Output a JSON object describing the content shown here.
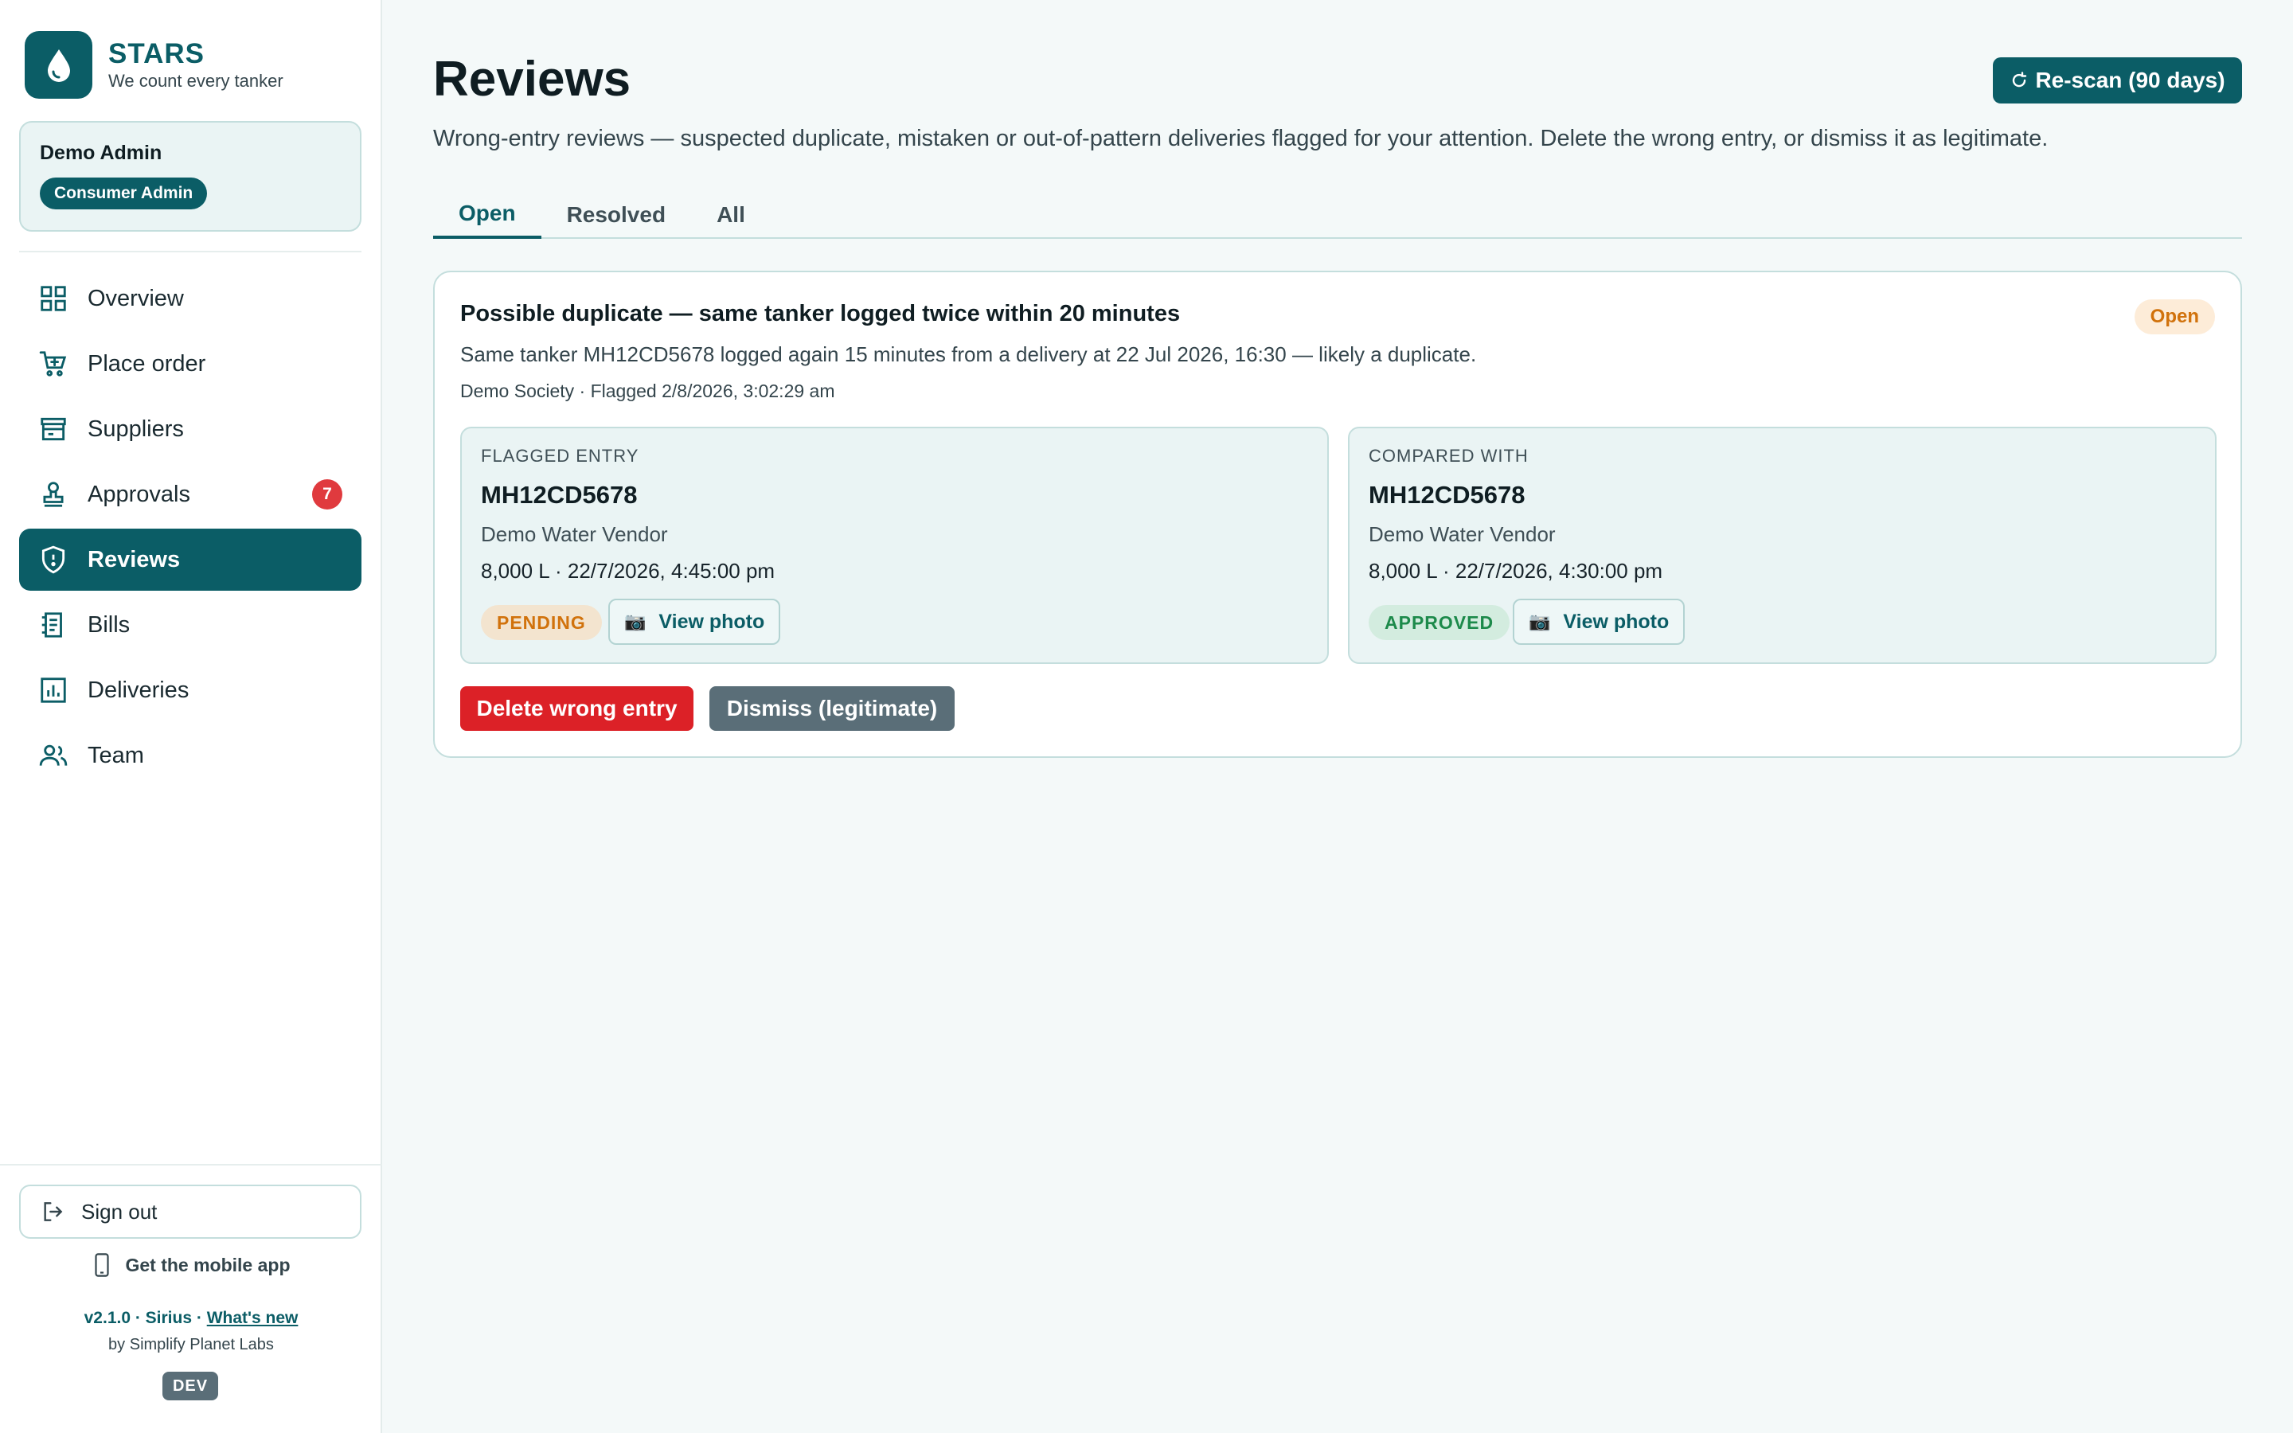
{
  "brand": {
    "name": "STARS",
    "tagline": "We count every tanker",
    "logo_icon": "water-drop-icon"
  },
  "user": {
    "name": "Demo Admin",
    "role": "Consumer Admin"
  },
  "nav": [
    {
      "label": "Overview",
      "icon": "grid-icon"
    },
    {
      "label": "Place order",
      "icon": "cart-icon"
    },
    {
      "label": "Suppliers",
      "icon": "store-icon"
    },
    {
      "label": "Approvals",
      "icon": "stamp-icon",
      "badge": "7"
    },
    {
      "label": "Reviews",
      "icon": "shield-icon",
      "active": true
    },
    {
      "label": "Bills",
      "icon": "receipt-icon"
    },
    {
      "label": "Deliveries",
      "icon": "bar-chart-icon"
    },
    {
      "label": "Team",
      "icon": "people-icon"
    }
  ],
  "footer": {
    "sign_out": "Sign out",
    "mobile_app": "Get the mobile app",
    "version": "v2.1.0 · Sirius · ",
    "whats_new": "What's new",
    "byline": "by Simplify Planet Labs",
    "env_badge": "DEV"
  },
  "page": {
    "title": "Reviews",
    "rescan_label": "Re-scan (90 days)",
    "subtitle": "Wrong-entry reviews — suspected duplicate, mistaken or out-of-pattern deliveries flagged for your attention. Delete the wrong entry, or dismiss it as legitimate."
  },
  "tabs": [
    {
      "label": "Open",
      "active": true
    },
    {
      "label": "Resolved"
    },
    {
      "label": "All"
    }
  ],
  "review": {
    "title": "Possible duplicate — same tanker logged twice within 20 minutes",
    "status": "Open",
    "description": "Same tanker MH12CD5678 logged again 15 minutes from a delivery at 22 Jul 2026, 16:30 — likely a duplicate.",
    "meta": "Demo Society · Flagged 2/8/2026, 3:02:29 am",
    "flagged": {
      "label": "FLAGGED ENTRY",
      "plate": "MH12CD5678",
      "vendor": "Demo Water Vendor",
      "detail": "8,000 L · 22/7/2026, 4:45:00 pm",
      "state": "PENDING",
      "photo_label": "View photo"
    },
    "compared": {
      "label": "COMPARED WITH",
      "plate": "MH12CD5678",
      "vendor": "Demo Water Vendor",
      "detail": "8,000 L · 22/7/2026, 4:30:00 pm",
      "state": "APPROVED",
      "photo_label": "View photo"
    },
    "delete_label": "Delete wrong entry",
    "dismiss_label": "Dismiss (legitimate)"
  },
  "colors": {
    "primary": "#0b5d66",
    "danger": "#dc2127",
    "muted": "#5a6e78",
    "pending": "#d1720c",
    "approved": "#1d8a4b"
  }
}
